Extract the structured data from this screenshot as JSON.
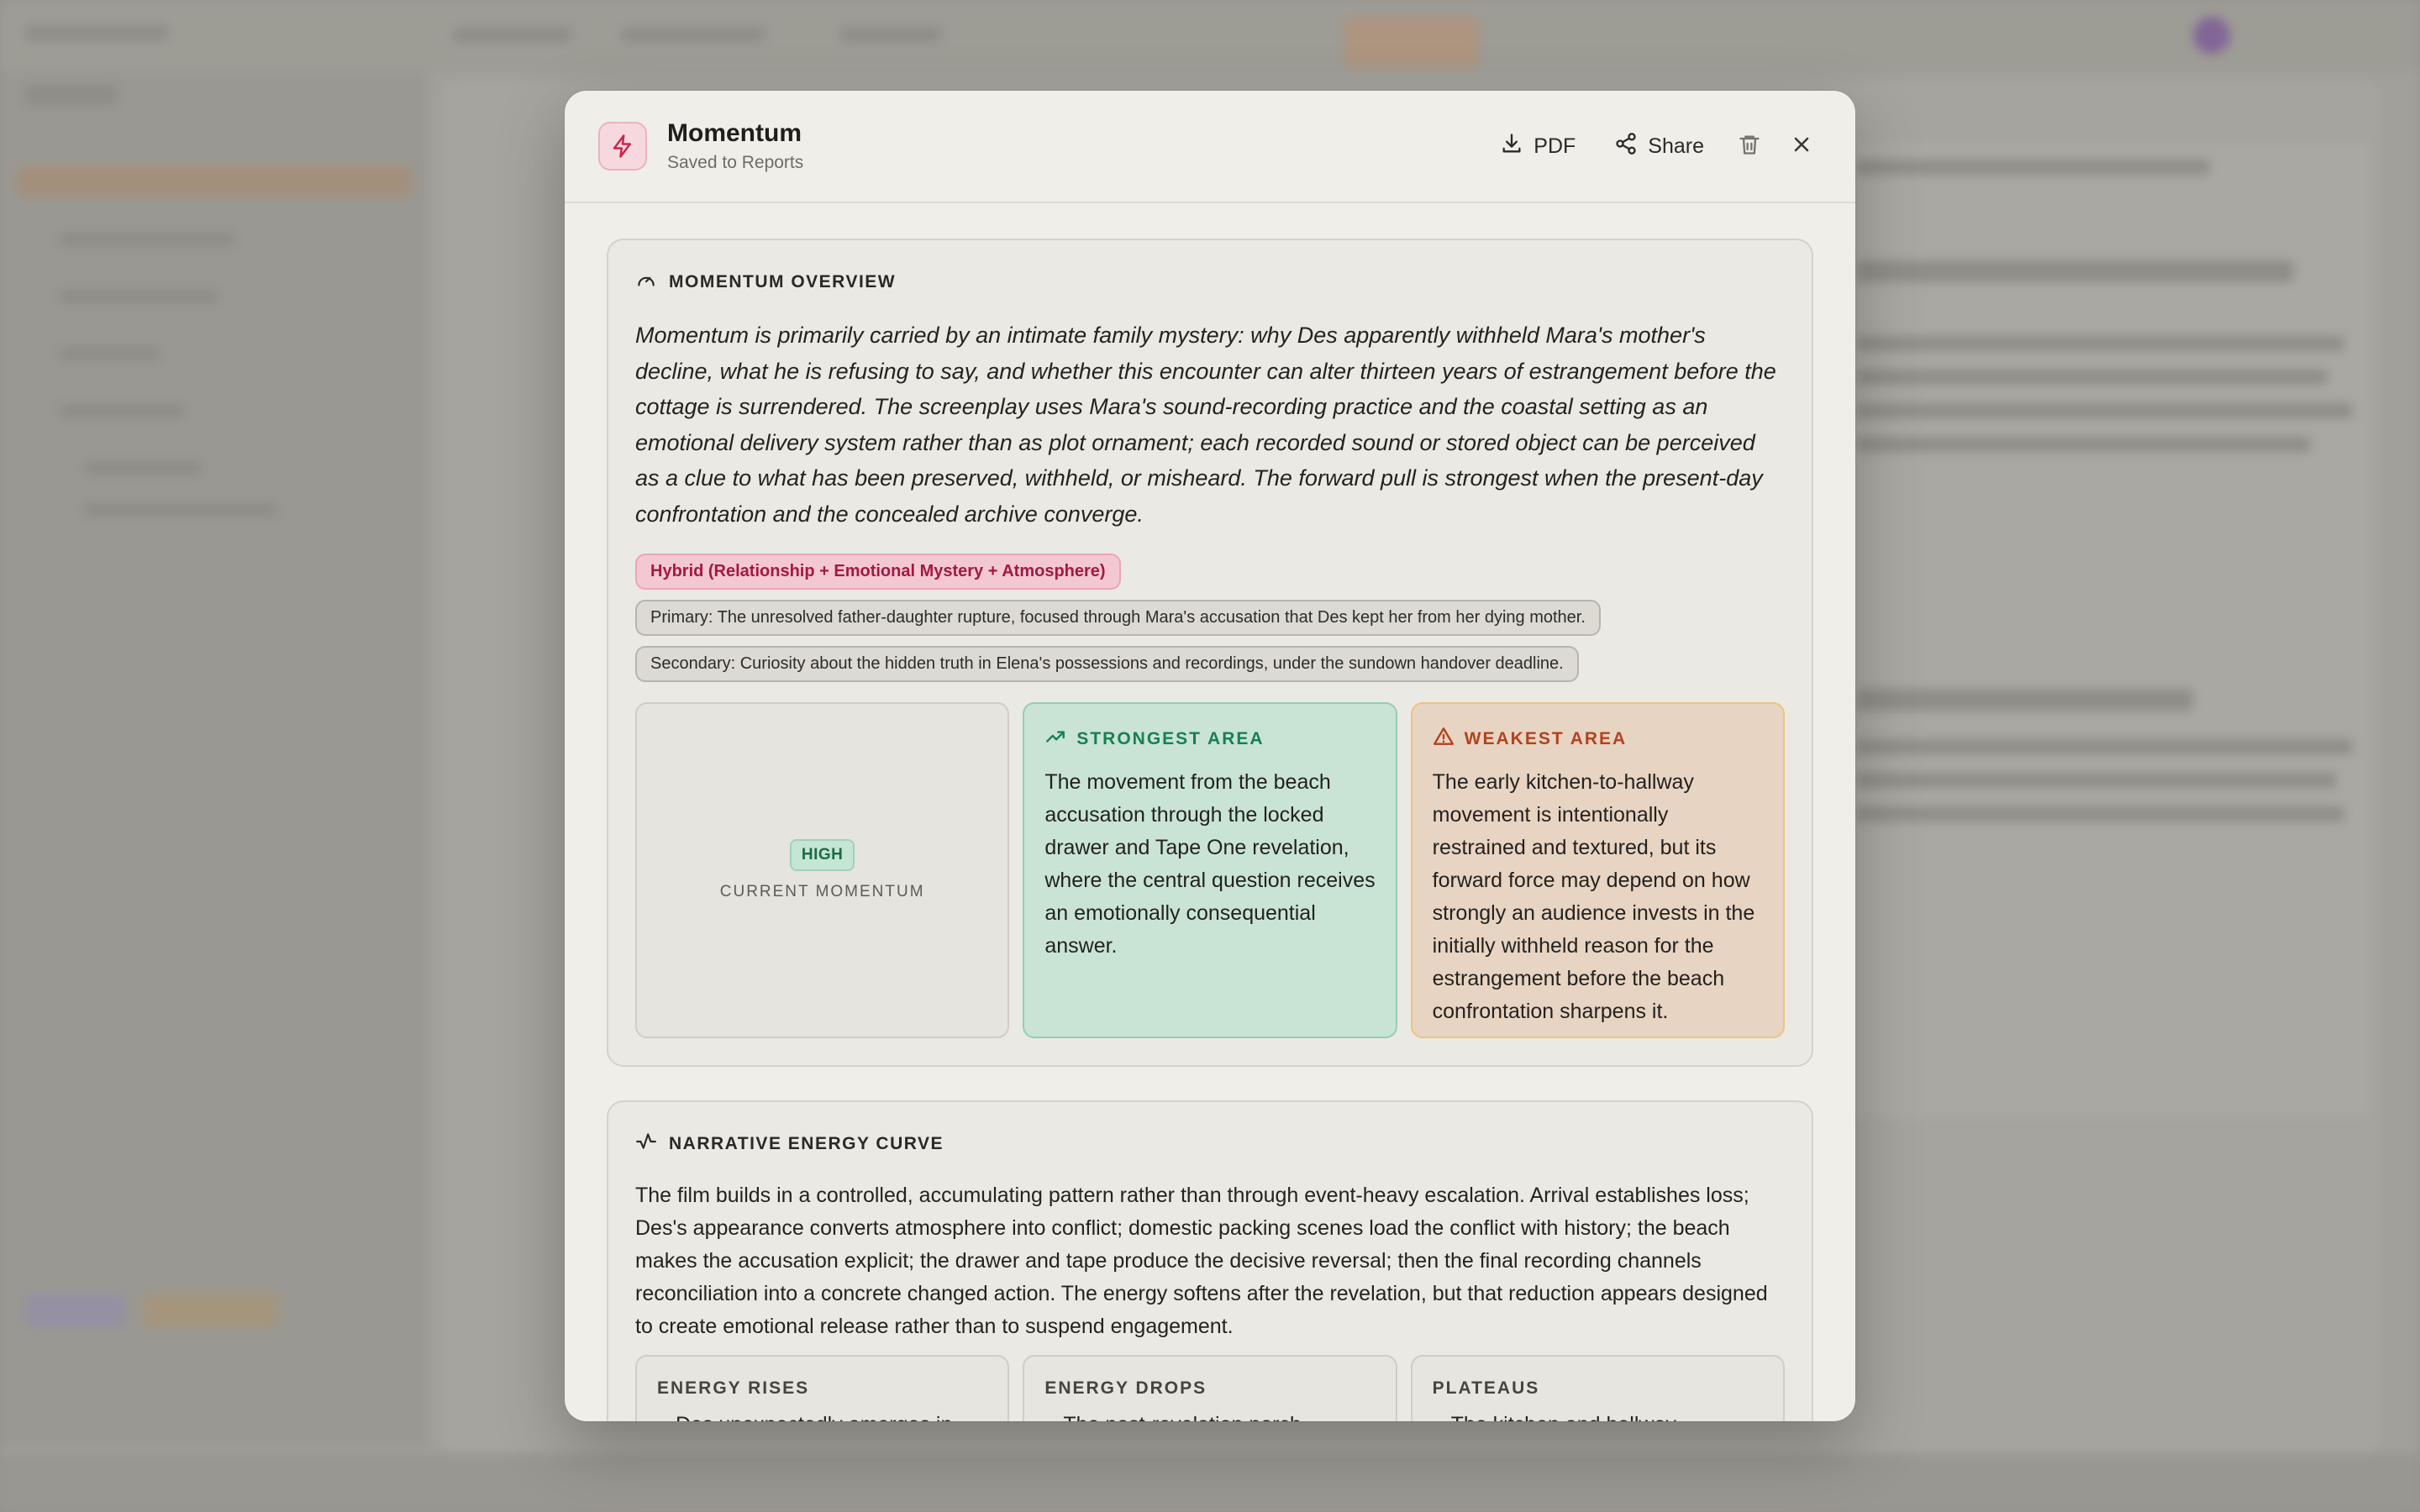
{
  "modal": {
    "title": "Momentum",
    "subtitle": "Saved to Reports",
    "actions": {
      "pdf_label": "PDF",
      "share_label": "Share"
    }
  },
  "overview": {
    "heading": "Momentum Overview",
    "text": "Momentum is primarily carried by an intimate family mystery: why Des apparently withheld Mara's mother's decline, what he is refusing to say, and whether this encounter can alter thirteen years of estrangement before the cottage is surrendered. The screenplay uses Mara's sound-recording practice and the coastal setting as an emotional delivery system rather than as plot ornament; each recorded sound or stored object can be perceived as a clue to what has been preserved, withheld, or misheard. The forward pull is strongest when the present-day confrontation and the concealed archive converge.",
    "tags": {
      "hybrid": "Hybrid (Relationship + Emotional Mystery + Atmosphere)",
      "primary": "Primary: The unresolved father-daughter rupture, focused through Mara's accusation that Des kept her from her dying mother.",
      "secondary": "Secondary: Curiosity about the hidden truth in Elena's possessions and recordings, under the sundown handover deadline."
    },
    "current": {
      "badge": "HIGH",
      "label": "Current Momentum"
    },
    "strongest": {
      "heading": "Strongest Area",
      "text": "The movement from the beach accusation through the locked drawer and Tape One revelation, where the central question receives an emotionally consequential answer."
    },
    "weakest": {
      "heading": "Weakest Area",
      "text": "The early kitchen-to-hallway movement is intentionally restrained and textured, but its forward force may depend on how strongly an audience invests in the initially withheld reason for the estrangement before the beach confrontation sharpens it."
    }
  },
  "energy": {
    "heading": "Narrative Energy Curve",
    "text": "The film builds in a controlled, accumulating pattern rather than through event-heavy escalation. Arrival establishes loss; Des's appearance converts atmosphere into conflict; domestic packing scenes load the conflict with history; the beach makes the accusation explicit; the drawer and tape produce the decisive reversal; then the final recording channels reconciliation into a concrete changed action. The energy softens after the revelation, but that reduction appears designed to create emotional release rather than to suspend engagement.",
    "columns": [
      {
        "title": "Energy Rises",
        "first_item": "Des unexpectedly emerges in",
        "dot_color": "#1f9a5e"
      },
      {
        "title": "Energy Drops",
        "first_item": "The post-revelation porch",
        "dot_color": "#d23a3a"
      },
      {
        "title": "Plateaus",
        "first_item": "The kitchen and hallway",
        "dot_color": "#d7701f"
      }
    ]
  },
  "colors": {
    "accent_pink": "#c8264f",
    "strong_green": "#178051",
    "weak_orange": "#b2431e"
  }
}
